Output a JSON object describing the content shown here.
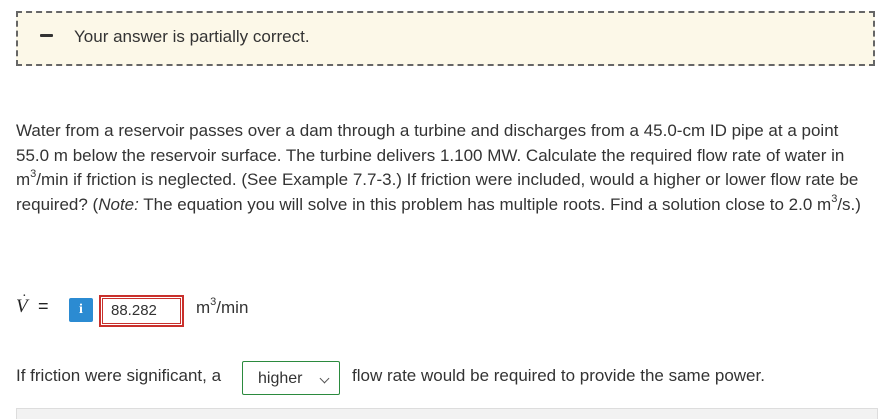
{
  "feedback": {
    "text": "Your answer is partially correct.",
    "icon": "minus-icon",
    "background_color": "#fcf8e8"
  },
  "problem": {
    "part1": "Water from a reservoir passes over a dam through a turbine and discharges from a 45.0-cm ID pipe at a point 55.0 m below the reservoir surface. The turbine delivers 1.100 MW. Calculate the required flow rate of water in m",
    "sup1": "3",
    "part2": "/min if friction is neglected. (See Example 7.7-3.) If friction were included, would a higher or lower flow rate be required? (",
    "note_label": "Note:",
    "part3": " The equation you will solve in this problem has multiple roots. Find a solution close to 2.0 m",
    "sup2": "3",
    "part4": "/s.)"
  },
  "answer_row": {
    "variable": "V",
    "dot": "·",
    "equals": "=",
    "info_label": "i",
    "value": "88.282",
    "unit_base": "m",
    "unit_sup": "3",
    "unit_tail": "/min",
    "error_color": "#c9302c"
  },
  "friction_row": {
    "text_before": "If friction were significant, a",
    "selected_option": "higher",
    "text_after": "flow rate would be required to provide the same power."
  },
  "accent_color": "#2b8bd2"
}
